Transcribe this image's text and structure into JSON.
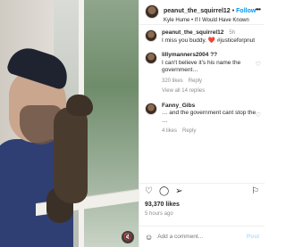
{
  "post": {
    "author": "peanut_the_squirrel12",
    "follow_label": "Follow",
    "audio": "Kyle Hume • If I Would Have Known",
    "more_label": "•••",
    "mute_label": "🔇"
  },
  "caption": {
    "username": "peanut_the_squirrel12",
    "time": "5h",
    "text": "I miss you buddy. ❤️ #justiceforpnut"
  },
  "comments": [
    {
      "username": "lillymanners2004 ??",
      "time": "",
      "text": "I can't believe it’s his name the government…",
      "meta": [
        "320 likes",
        "Reply"
      ],
      "replies": "View all 14 replies"
    },
    {
      "username": "Fanny_Gibs",
      "time": "",
      "text": "… and the government cant stop the …",
      "meta": [
        "4 likes",
        "Reply"
      ],
      "replies": ""
    }
  ],
  "stats": {
    "likes": "93,370 likes",
    "posted": "5 hours ago"
  },
  "composer": {
    "placeholder": "Add a comment...",
    "post_label": "Post"
  }
}
